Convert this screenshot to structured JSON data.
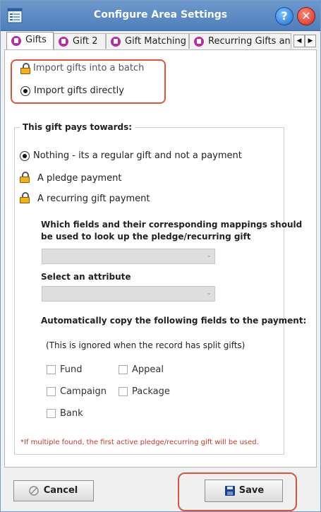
{
  "window": {
    "title": "Configure Area Settings",
    "help_glyph": "?",
    "close_glyph": "✕"
  },
  "tabs": [
    {
      "label": "Gifts",
      "active": true
    },
    {
      "label": "Gift 2",
      "active": false
    },
    {
      "label": "Gift Matching",
      "active": false
    },
    {
      "label": "Recurring Gifts and",
      "active": false
    }
  ],
  "tab_scroll": {
    "left_glyph": "◀",
    "right_glyph": "▶"
  },
  "import_mode": {
    "options": [
      {
        "label": "Import gifts into a batch",
        "locked": true,
        "selected": false
      },
      {
        "label": "Import gifts directly",
        "locked": false,
        "selected": true
      }
    ]
  },
  "pays_towards": {
    "legend": "This gift pays towards:",
    "options": [
      {
        "label": "Nothing - its a regular gift and not a payment",
        "selected": true,
        "locked": false
      },
      {
        "label": "A pledge payment",
        "selected": false,
        "locked": true
      },
      {
        "label": "A recurring gift payment",
        "selected": false,
        "locked": true
      }
    ],
    "lookup_label_line1": "Which fields and their corresponding mappings should",
    "lookup_label_line2": "be used to look up the  pledge/recurring gift",
    "lookup_value": "",
    "attribute_label": "Select an attribute",
    "attribute_value": "",
    "copy_label": "Automatically copy the following fields to the payment:",
    "copy_note": "(This is ignored when the record has split gifts)",
    "copy_fields": [
      {
        "label": "Fund",
        "checked": false
      },
      {
        "label": "Appeal",
        "checked": false
      },
      {
        "label": "Campaign",
        "checked": false
      },
      {
        "label": "Package",
        "checked": false
      },
      {
        "label": "Bank",
        "checked": false
      }
    ],
    "footnote": "*If multiple found, the first active pledge/recurring gift will be used."
  },
  "footer": {
    "cancel_label": "Cancel",
    "save_label": "Save"
  },
  "colors": {
    "title_bar": "#5b8ac4",
    "highlight": "#e0533b",
    "note_text": "#c0392b"
  }
}
